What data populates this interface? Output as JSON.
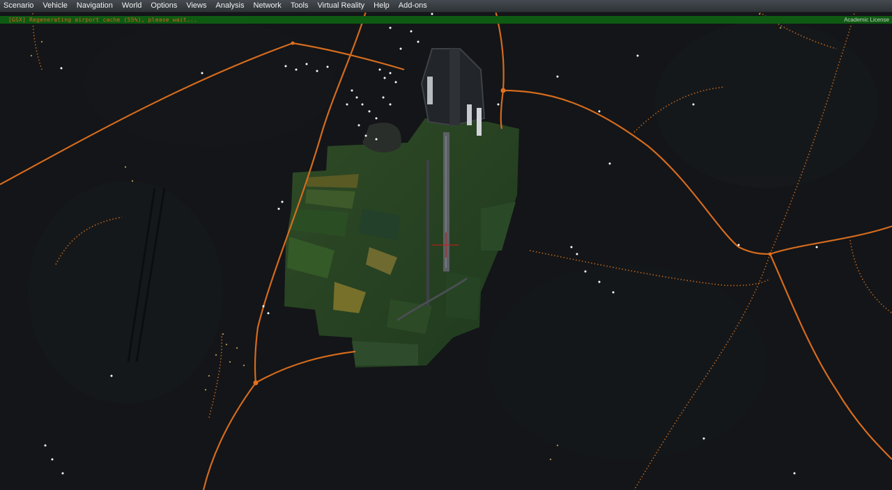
{
  "menu": {
    "items": [
      "Scenario",
      "Vehicle",
      "Navigation",
      "World",
      "Options",
      "Views",
      "Analysis",
      "Network",
      "Tools",
      "Virtual Reality",
      "Help",
      "Add-ons"
    ]
  },
  "status": {
    "message": "[GSX] Regenerating airport cache (55%), please wait...",
    "license": "Academic License",
    "progress_percent": 55
  },
  "colors": {
    "menubar": "#3a3f44",
    "status_bar": "#0f5a12",
    "status_text": "#d9631f",
    "road": "#e0701e",
    "ground": "#131518",
    "lights": "#ffffff",
    "crosshair": "#d01818"
  }
}
